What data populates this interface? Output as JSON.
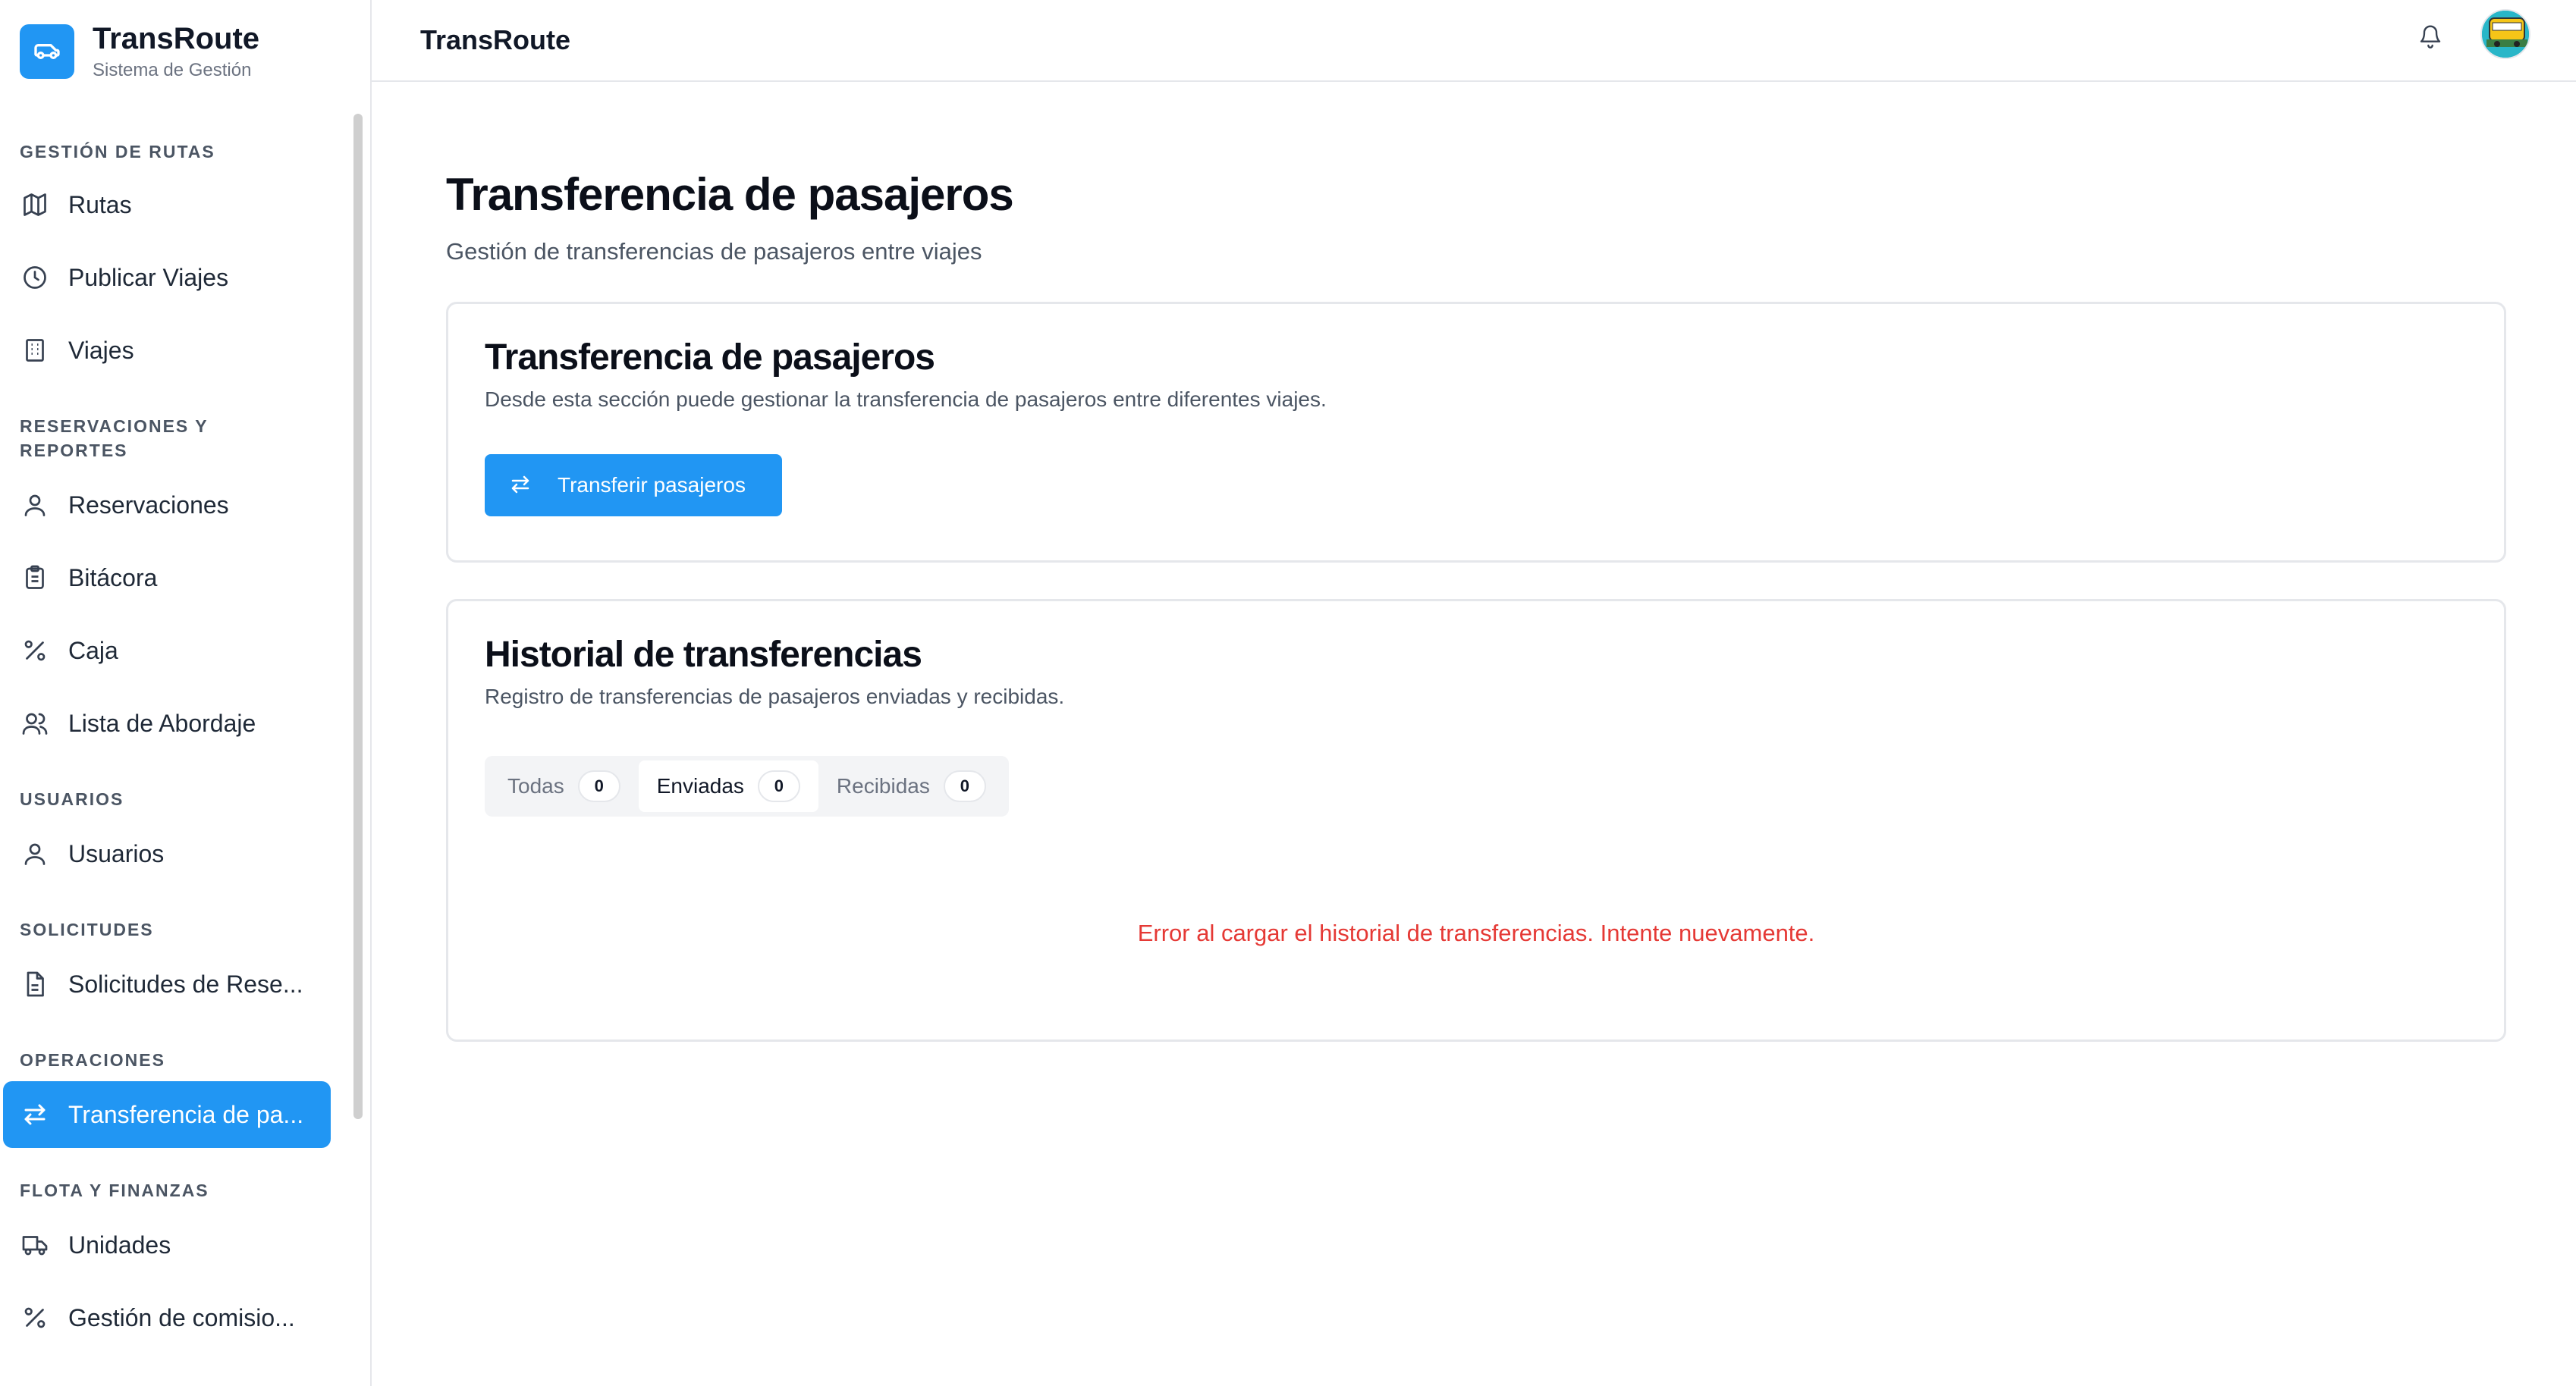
{
  "brand": {
    "name": "TransRoute",
    "subtitle": "Sistema de Gestión",
    "logo_icon": "van-icon"
  },
  "sidebar": {
    "sections": [
      {
        "title": "GESTIÓN DE RUTAS",
        "items": [
          {
            "label": "Rutas",
            "icon": "map-icon"
          },
          {
            "label": "Publicar Viajes",
            "icon": "clock-icon"
          },
          {
            "label": "Viajes",
            "icon": "building-icon"
          }
        ]
      },
      {
        "title": "RESERVACIONES Y REPORTES",
        "items": [
          {
            "label": "Reservaciones",
            "icon": "user-icon"
          },
          {
            "label": "Bitácora",
            "icon": "clipboard-icon"
          },
          {
            "label": "Caja",
            "icon": "percent-icon"
          },
          {
            "label": "Lista de Abordaje",
            "icon": "users-icon"
          }
        ]
      },
      {
        "title": "USUARIOS",
        "items": [
          {
            "label": "Usuarios",
            "icon": "user-icon"
          }
        ]
      },
      {
        "title": "SOLICITUDES",
        "items": [
          {
            "label": "Solicitudes de Rese...",
            "icon": "document-icon"
          }
        ]
      },
      {
        "title": "OPERACIONES",
        "items": [
          {
            "label": "Transferencia de pa...",
            "icon": "transfer-icon",
            "active": true
          }
        ]
      },
      {
        "title": "FLOTA Y FINANZAS",
        "items": [
          {
            "label": "Unidades",
            "icon": "truck-icon"
          },
          {
            "label": "Gestión de comisio...",
            "icon": "percent-icon"
          }
        ]
      }
    ]
  },
  "header": {
    "title": "TransRoute",
    "bell_icon": "bell-icon",
    "avatar_icon": "avatar-icon"
  },
  "page": {
    "title": "Transferencia de pasajeros",
    "subtitle": "Gestión de transferencias de pasajeros entre viajes"
  },
  "transfer_card": {
    "title": "Transferencia de pasajeros",
    "description": "Desde esta sección puede gestionar la transferencia de pasajeros entre diferentes viajes.",
    "button_label": "Transferir pasajeros"
  },
  "history_card": {
    "title": "Historial de transferencias",
    "description": "Registro de transferencias de pasajeros enviadas y recibidas.",
    "tabs": [
      {
        "label": "Todas",
        "count": "0"
      },
      {
        "label": "Enviadas",
        "count": "0"
      },
      {
        "label": "Recibidas",
        "count": "0"
      }
    ],
    "active_tab": "Enviadas",
    "error": "Error al cargar el historial de transferencias. Intente nuevamente."
  },
  "colors": {
    "primary": "#2196f3",
    "error": "#e53935",
    "border": "#e5e7eb"
  }
}
